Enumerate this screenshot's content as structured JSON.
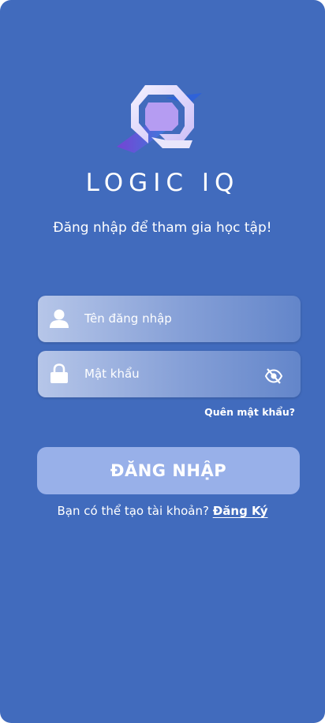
{
  "brand": {
    "name": "LOGIC IQ",
    "logo_icon": "logic-iq-logo"
  },
  "login": {
    "subtitle": "Đăng nhập để tham gia học tập!",
    "username_placeholder": "Tên đăng nhập",
    "password_placeholder": "Mật khẩu",
    "forgot_password": "Quên mật khẩu?",
    "submit_label": "ĐĂNG NHẬP",
    "signup_prompt": "Bạn có thể tạo tài khoản?",
    "signup_link": "Đăng Ký"
  },
  "icons": {
    "username": "user-icon",
    "password": "lock-icon",
    "toggle_visibility": "eye-off-icon"
  },
  "colors": {
    "background": "#416bbd",
    "button": "#98b0e9",
    "text": "#ffffff"
  }
}
